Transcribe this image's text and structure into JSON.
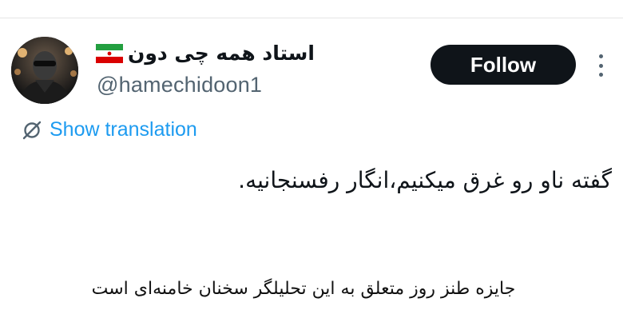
{
  "tweet": {
    "author": {
      "display_name": "استاد همه چی دون",
      "flag_icon": "iran-flag-icon",
      "handle": "@hamechidoon1",
      "avatar_icon": "avatar-photo"
    },
    "follow_label": "Follow",
    "more_icon": "more-vertical-icon",
    "translation": {
      "icon": "translate-icon",
      "label": "Show translation"
    },
    "body": "گفته ناو رو غرق میکنیم،انگار رفسنجانیه."
  },
  "caption": "جایزه طنز روز متعلق به این تحلیلگر سخنان خامنه‌ای است",
  "colors": {
    "text": "#0f1419",
    "secondary": "#536471",
    "link": "#1d9bf0",
    "button_bg": "#0f1419",
    "button_text": "#ffffff"
  }
}
